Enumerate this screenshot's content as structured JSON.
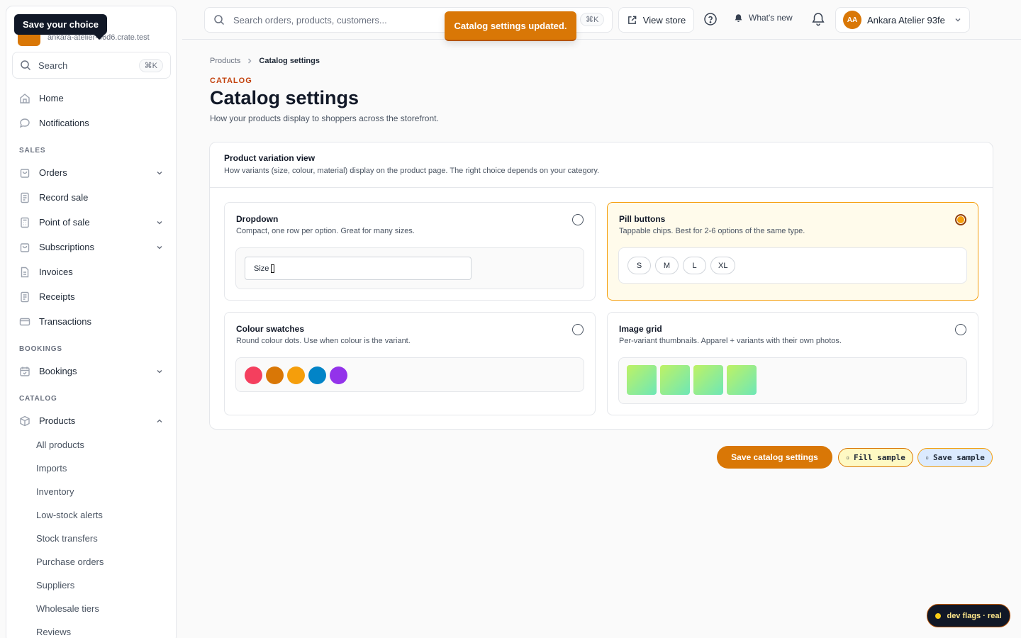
{
  "sidebar": {
    "tooltip": "Save your choice",
    "brand_domain": "ankara-atelier-46d6.crate.test",
    "search": {
      "label": "Search",
      "shortcut": "⌘K"
    },
    "nav": [
      {
        "label": "Home",
        "icon": "home-icon"
      },
      {
        "label": "Notifications",
        "icon": "chat-bubble-icon"
      }
    ],
    "sections": {
      "sales": "SALES",
      "bookings": "BOOKINGS",
      "catalog": "CATALOG"
    },
    "sales_items": [
      {
        "label": "Orders",
        "icon": "bag-icon",
        "expandable": true
      },
      {
        "label": "Record sale",
        "icon": "receipt-icon",
        "expandable": false
      },
      {
        "label": "Point of sale",
        "icon": "calculator-icon",
        "expandable": true
      },
      {
        "label": "Subscriptions",
        "icon": "bag-icon",
        "expandable": true
      },
      {
        "label": "Invoices",
        "icon": "document-icon",
        "expandable": false
      },
      {
        "label": "Receipts",
        "icon": "receipt-icon",
        "expandable": false
      },
      {
        "label": "Transactions",
        "icon": "card-icon",
        "expandable": false
      }
    ],
    "bookings_items": [
      {
        "label": "Bookings",
        "icon": "calendar-icon",
        "expandable": true
      }
    ],
    "catalog_items": [
      {
        "label": "Products",
        "icon": "box-icon",
        "expanded": true
      }
    ],
    "product_subitems": [
      "All products",
      "Imports",
      "Inventory",
      "Low-stock alerts",
      "Stock transfers",
      "Purchase orders",
      "Suppliers",
      "Wholesale tiers",
      "Reviews"
    ]
  },
  "topbar": {
    "search_placeholder": "Search orders, products, customers...",
    "search_shortcut": "⌘K",
    "view_store": "View store",
    "whats_new": "What's new",
    "account_initials": "AA",
    "account_name": "Ankara Atelier 93fe"
  },
  "toast": "Catalog settings updated.",
  "breadcrumb": {
    "parent": "Products",
    "current": "Catalog settings"
  },
  "page": {
    "eyebrow": "CATALOG",
    "title": "Catalog settings",
    "subtitle": "How your products display to shoppers across the storefront."
  },
  "variation": {
    "title": "Product variation view",
    "description": "How variants (size, colour, material) display on the product page. The right choice depends on your category.",
    "selected": "pill",
    "options": {
      "dropdown": {
        "title": "Dropdown",
        "description": "Compact, one row per option. Great for many sizes.",
        "preview_label": "Size"
      },
      "pill": {
        "title": "Pill buttons",
        "description": "Tappable chips. Best for 2-6 options of the same type.",
        "sizes": [
          "S",
          "M",
          "L",
          "XL"
        ]
      },
      "swatch": {
        "title": "Colour swatches",
        "description": "Round colour dots. Use when colour is the variant.",
        "colors": [
          "#f43f5e",
          "#d97706",
          "#f59e0b",
          "#0284c7",
          "#9333ea"
        ]
      },
      "grid": {
        "title": "Image grid",
        "description": "Per-variant thumbnails. Apparel + variants with their own photos.",
        "thumb_count": 4
      }
    }
  },
  "actions": {
    "save": "Save catalog settings",
    "fill_sample": "Fill sample",
    "save_sample": "Save sample"
  },
  "dev_flags": "dev flags · real",
  "colors": {
    "accent": "#d97706",
    "selected_bg": "#fffbeb",
    "selected_border": "#f59e0b"
  }
}
